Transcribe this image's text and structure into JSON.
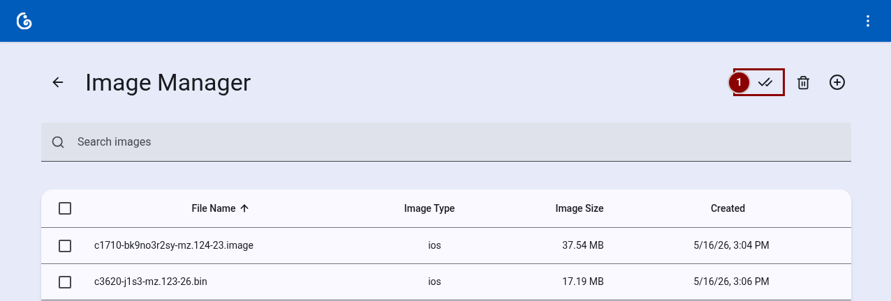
{
  "page": {
    "title": "Image Manager"
  },
  "tour": {
    "badge": "1"
  },
  "search": {
    "placeholder": "Search images"
  },
  "table": {
    "columns": [
      {
        "label": "File Name",
        "sorted": true
      },
      {
        "label": "Image Type",
        "sorted": false
      },
      {
        "label": "Image Size",
        "sorted": false
      },
      {
        "label": "Created",
        "sorted": false
      }
    ],
    "all_checked": false,
    "rows": [
      {
        "checked": false,
        "cells": [
          "c1710-bk9no3r2sy-mz.124-23.image",
          "ios",
          "37.54 MB",
          "5/16/26, 3:04 PM"
        ]
      },
      {
        "checked": false,
        "cells": [
          "c3620-j1s3-mz.123-26.bin",
          "ios",
          "17.19 MB",
          "5/16/26, 3:06 PM"
        ]
      }
    ]
  }
}
